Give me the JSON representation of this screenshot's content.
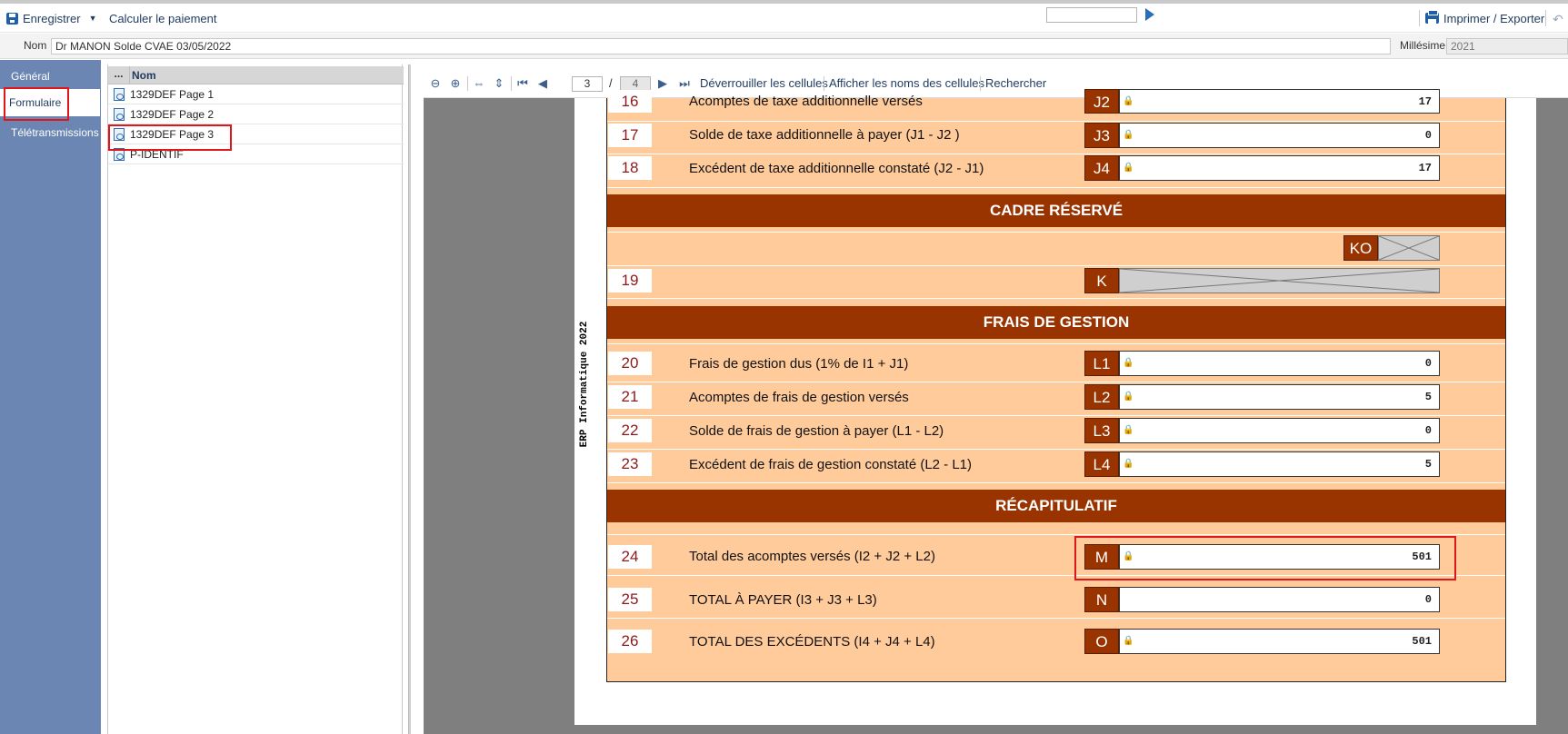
{
  "toolbar": {
    "save_label": "Enregistrer",
    "calc_label": "Calculer le paiement",
    "print_label": "Imprimer / Exporter"
  },
  "name_row": {
    "nom_label": "Nom",
    "nom_value": "Dr MANON Solde CVAE 03/05/2022",
    "millesime_label": "Millésime",
    "millesime_value": "2021"
  },
  "nav": {
    "items": [
      "Général",
      "Formulaire",
      "Télétransmissions"
    ],
    "active": "Formulaire"
  },
  "tree": {
    "col_dots": "...",
    "col_nom": "Nom",
    "rows": [
      "1329DEF Page 1",
      "1329DEF Page 2",
      "1329DEF Page 3",
      "P-IDENTIF"
    ],
    "selected": "1329DEF Page 3"
  },
  "viewer": {
    "page_current": "3",
    "page_sep": "/",
    "page_total": "4",
    "unlock_label": "Déverrouiller les cellules",
    "show_names_label": "Afficher les noms des cellules",
    "search_label": "Rechercher",
    "search_value": ""
  },
  "form": {
    "vertical_text": "ERP Informatique 2022",
    "rows_top": [
      {
        "num": "16",
        "desc": "Acomptes de taxe additionnelle versés",
        "code": "J2",
        "value": "17"
      },
      {
        "num": "17",
        "desc": "Solde de taxe additionnelle à payer (J1 - J2 )",
        "code": "J3",
        "value": "0"
      },
      {
        "num": "18",
        "desc": "Excédent de taxe additionnelle constaté (J2 - J1)",
        "code": "J4",
        "value": "17"
      }
    ],
    "section_reserve": "CADRE RÉSERVÉ",
    "reserve": {
      "ko_code": "KO",
      "num": "19",
      "k_code": "K"
    },
    "section_frais": "FRAIS DE GESTION",
    "rows_frais": [
      {
        "num": "20",
        "desc": "Frais de gestion dus (1% de I1 + J1)",
        "code": "L1",
        "value": "0"
      },
      {
        "num": "21",
        "desc": "Acomptes de frais de gestion versés",
        "code": "L2",
        "value": "5"
      },
      {
        "num": "22",
        "desc": "Solde de frais de gestion à payer (L1 - L2)",
        "code": "L3",
        "value": "0"
      },
      {
        "num": "23",
        "desc": "Excédent de frais de gestion constaté (L2 - L1)",
        "code": "L4",
        "value": "5"
      }
    ],
    "section_recap": "RÉCAPITULATIF",
    "rows_recap": [
      {
        "num": "24",
        "desc": "Total des acomptes versés   (I2 + J2 + L2)",
        "code": "M",
        "value": "501"
      },
      {
        "num": "25",
        "desc": "TOTAL À PAYER   (I3 + J3 + L3)",
        "code": "N",
        "value": "0"
      },
      {
        "num": "26",
        "desc": "TOTAL DES EXCÉDENTS   (I4 + J4 + L4)",
        "code": "O",
        "value": "501"
      }
    ]
  }
}
